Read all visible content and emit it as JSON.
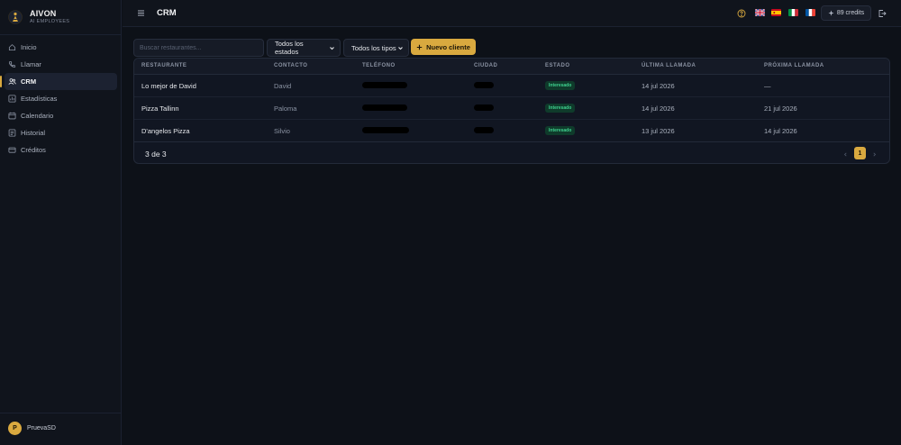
{
  "brand": {
    "name": "AIVON",
    "subtitle": "AI EMPLOYEES"
  },
  "sidebar": {
    "items": [
      {
        "label": "Inicio",
        "icon": "home-icon",
        "active": false
      },
      {
        "label": "Llamar",
        "icon": "phone-icon",
        "active": false
      },
      {
        "label": "CRM",
        "icon": "users-icon",
        "active": true
      },
      {
        "label": "Estadísticas",
        "icon": "bar-chart-icon",
        "active": false
      },
      {
        "label": "Calendario",
        "icon": "calendar-icon",
        "active": false
      },
      {
        "label": "Historial",
        "icon": "history-icon",
        "active": false
      },
      {
        "label": "Créditos",
        "icon": "credit-card-icon",
        "active": false
      }
    ],
    "user": {
      "initial": "P",
      "name": "PruevaSD"
    }
  },
  "header": {
    "title": "CRM",
    "credits_label": "89 credits",
    "flags": [
      "uk-flag-icon",
      "spain-flag-icon",
      "italy-flag-icon",
      "france-flag-icon"
    ]
  },
  "toolbar": {
    "search_placeholder": "Buscar restaurantes...",
    "status_filter": "Todos los estados",
    "type_filter": "Todos los tipos",
    "new_button": "Nuevo cliente"
  },
  "table": {
    "columns": [
      "RESTAURANTE",
      "CONTACTO",
      "TELÉFONO",
      "CIUDAD",
      "ESTADO",
      "ÚLTIMA LLAMADA",
      "PRÓXIMA LLAMADA"
    ],
    "rows": [
      {
        "restaurant": "Lo mejor de David",
        "contact": "David",
        "status": "Interesado",
        "last_call": "14 jul 2026",
        "next_call": "—"
      },
      {
        "restaurant": "Pizza Tallinn",
        "contact": "Paloma",
        "status": "Interesado",
        "last_call": "14 jul 2026",
        "next_call": "21 jul 2026"
      },
      {
        "restaurant": "D'angelos Pizza",
        "contact": "Silvio",
        "status": "Interesado",
        "last_call": "13 jul 2026",
        "next_call": "14 jul 2026"
      }
    ],
    "count_label": "3 de 3",
    "current_page": "1"
  },
  "colors": {
    "accent": "#d9a93f",
    "background": "#0d1118",
    "panel": "#111622",
    "badge_text": "#3fd18f",
    "badge_bg": "#0f3b2b"
  }
}
